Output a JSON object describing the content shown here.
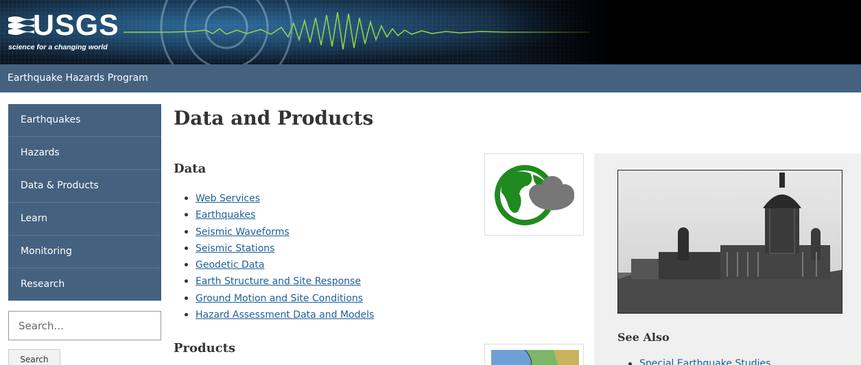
{
  "banner": {
    "logo_text": "USGS",
    "tagline": "science for a changing world"
  },
  "program": {
    "title": "Earthquake Hazards Program"
  },
  "nav": {
    "items": [
      {
        "label": "Earthquakes"
      },
      {
        "label": "Hazards"
      },
      {
        "label": "Data & Products"
      },
      {
        "label": "Learn"
      },
      {
        "label": "Monitoring"
      },
      {
        "label": "Research"
      }
    ]
  },
  "search": {
    "placeholder": "Search...",
    "button_label": "Search"
  },
  "main": {
    "title": "Data and Products",
    "data_heading": "Data",
    "data_links": [
      "Web Services",
      "Earthquakes",
      "Seismic Waveforms",
      "Seismic Stations",
      "Geodetic Data",
      "Earth Structure and Site Response",
      "Ground Motion and Site Conditions",
      "Hazard Assessment Data and Models"
    ],
    "products_heading": "Products"
  },
  "sidebar": {
    "see_also_heading": "See Also",
    "see_also_links": [
      "Special Earthquake Studies"
    ]
  },
  "colors": {
    "nav_bg": "#44627f",
    "link": "#1c5f97",
    "sidebar_bg": "#f0f0f0",
    "globe_green": "#1f8a1f"
  }
}
